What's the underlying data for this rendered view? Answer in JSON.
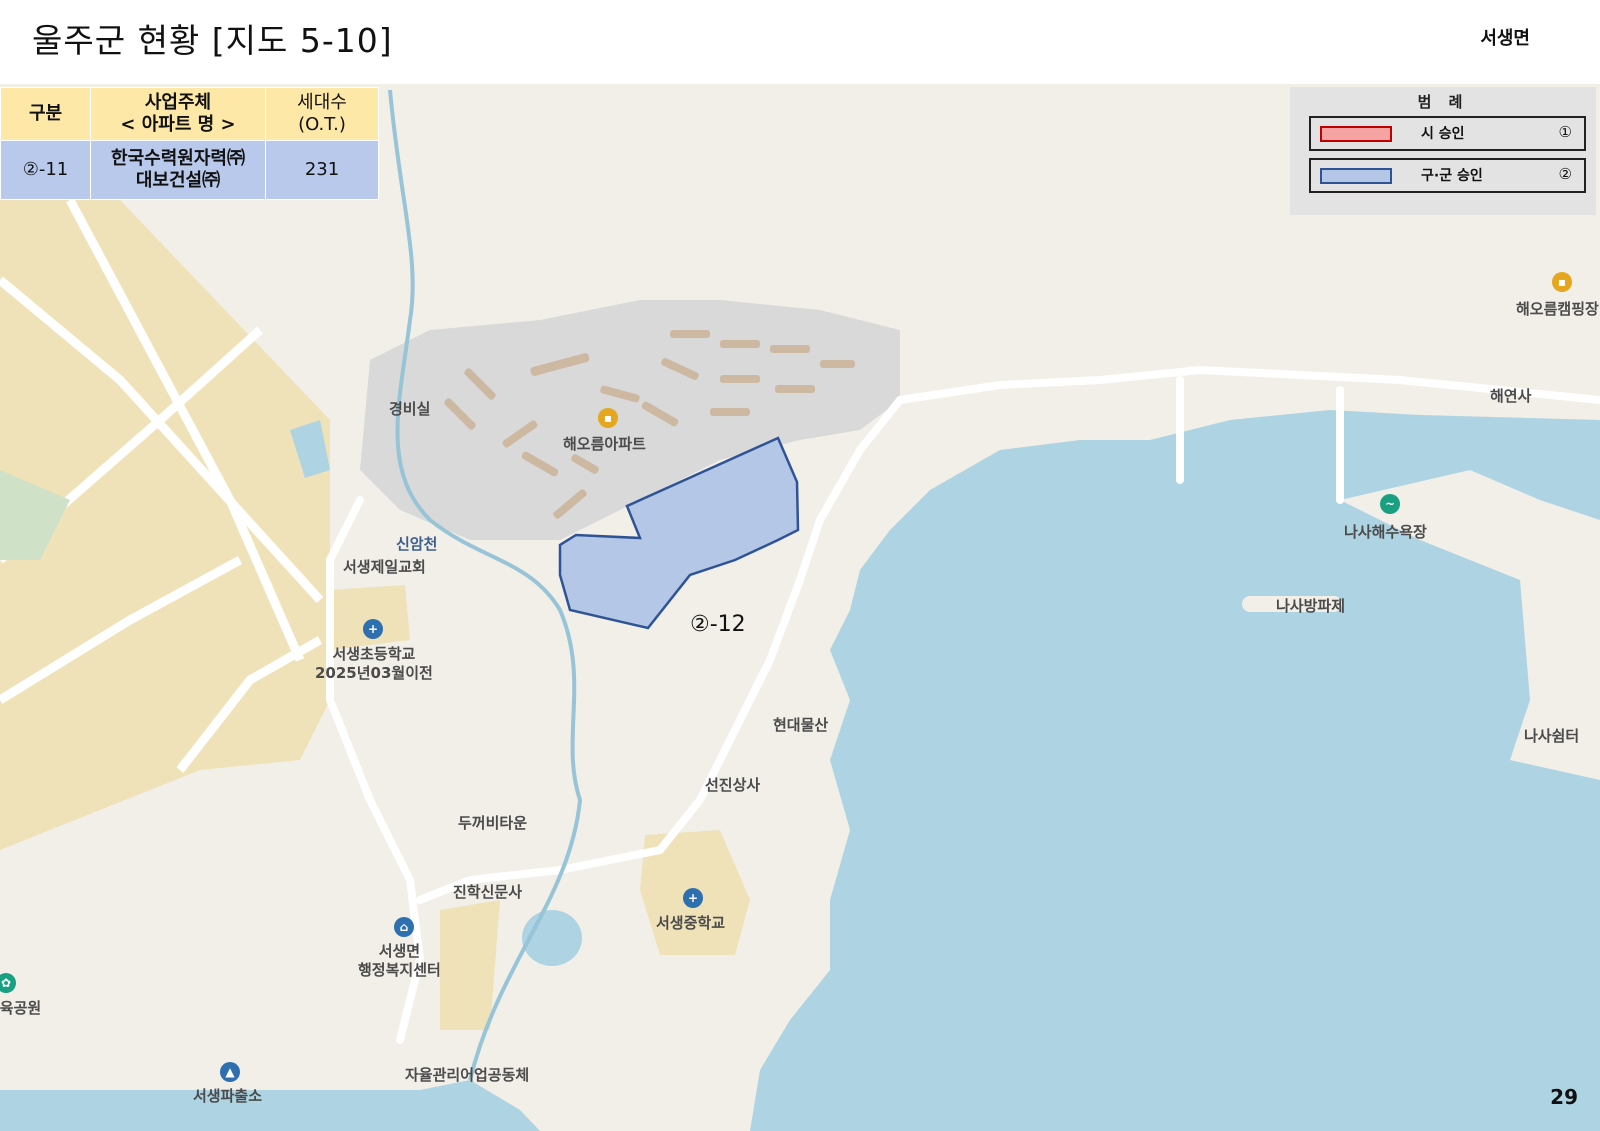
{
  "header": {
    "title": "울주군 현황 [지도 5-10]",
    "region": "서생면"
  },
  "table": {
    "headers": [
      "구분",
      "사업주체",
      "< 아파트 명 >",
      "세대수",
      "(O.T.)"
    ],
    "row": {
      "category": "②-11",
      "company_line1": "한국수력원자력㈜",
      "company_line2": "대보건설㈜",
      "households": "231"
    }
  },
  "legend": {
    "title": "범 례",
    "items": [
      {
        "label": "시 승인",
        "num": "①",
        "fill": "#f5a3a3",
        "stroke": "#c00000"
      },
      {
        "label": "구·군 승인",
        "num": "②",
        "fill": "#b4c7e7",
        "stroke": "#2f5496"
      }
    ]
  },
  "parcel": {
    "label": "②-12",
    "fill": "#b4c7e7",
    "stroke": "#2f5496"
  },
  "map_labels": {
    "gyeongbisil": "경비실",
    "haeoreum_apt": "해오름아파트",
    "sinamcheon": "신암천",
    "church": "서생제일교회",
    "elementary_1": "서생초등학교",
    "elementary_2": "2025년03월이전",
    "hyundai": "현대물산",
    "seonjin": "선진상사",
    "dukkebi": "두꺼비타운",
    "jinhak": "진학신문사",
    "middle_school": "서생중학교",
    "welfare_1": "서생면",
    "welfare_2": "행정복지센터",
    "park": "체육공원",
    "police": "서생파출소",
    "fishery": "자율관리어업공동체",
    "nasa_beach": "나사해수욕장",
    "breakwater": "나사방파제",
    "haeyeonsa": "해연사",
    "camping": "해오름캠핑장",
    "nasa_shelter": "나사쉼터"
  },
  "colors": {
    "land": "#f1efe8",
    "sea": "#aed3e3",
    "industrial": "#efe2b8",
    "apartment_area": "#d9d9d9",
    "building": "#cdb8a2",
    "road": "#ffffff"
  },
  "page_number": "29"
}
